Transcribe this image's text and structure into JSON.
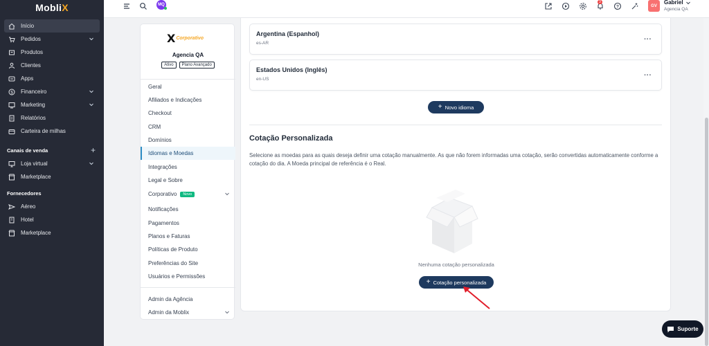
{
  "app": {
    "logo_main": "Mobli",
    "logo_x": "X"
  },
  "sidebar": {
    "items": [
      {
        "label": "Início",
        "icon": "home-icon"
      },
      {
        "label": "Pedidos",
        "icon": "cart-icon"
      },
      {
        "label": "Produtos",
        "icon": "box-icon"
      },
      {
        "label": "Clientes",
        "icon": "users-icon"
      },
      {
        "label": "Apps",
        "icon": "apps-icon"
      },
      {
        "label": "Financeiro",
        "icon": "dollar-icon"
      },
      {
        "label": "Marketing",
        "icon": "megaphone-icon"
      },
      {
        "label": "Relatórios",
        "icon": "report-icon"
      },
      {
        "label": "Carteira de milhas",
        "icon": "wallet-icon"
      }
    ],
    "sections": [
      {
        "title": "Canais de venda",
        "items": [
          {
            "label": "Loja virtual"
          },
          {
            "label": "Marketplace"
          }
        ]
      },
      {
        "title": "Fornecedores",
        "items": [
          {
            "label": "Aéreo"
          },
          {
            "label": "Hotel"
          },
          {
            "label": "Marketplace"
          }
        ]
      }
    ]
  },
  "topbar": {
    "avatar_initials": "MQ",
    "notif_count": "3",
    "user_initials": "GV",
    "user_name": "Gabriel",
    "user_agency": "Agencia QA"
  },
  "settings_menu": {
    "brand_x": "X",
    "brand_text": "Corporativo",
    "agency": "Agencia QA",
    "badge_active": "Ativo",
    "badge_plan": "Plano Avançado",
    "items": [
      "Geral",
      "Afiliados e Indicações",
      "Checkout",
      "CRM",
      "Domínios",
      "Idiomas e Moedas",
      "Integrações",
      "Legal e Sobre",
      "Corporativo",
      "Notificações",
      "Pagamentos",
      "Planos e Faturas",
      "Políticas de Produto",
      "Preferências do Site",
      "Usuários e Permissões"
    ],
    "corporativo_badge": "Novo",
    "footer_items": [
      "Admin da Agência",
      "Admin da Moblix"
    ]
  },
  "main": {
    "languages": [
      {
        "name": "Argentina (Espanhol)",
        "code": "es-AR"
      },
      {
        "name": "Estados Unidos (Inglês)",
        "code": "en-US"
      }
    ],
    "new_language_button": "Novo idioma",
    "section_title": "Cotação Personalizada",
    "section_desc": "Selecione as moedas para as quais deseja definir uma cotação manualmente. As que não forem informadas uma cotação, serão convertidas automaticamente conforme a cotação do dia. A Moeda principal de referência é o Real.",
    "empty_text": "Nenhuma cotação personalizada",
    "custom_quote_button": "Cotação personalizada"
  },
  "support": {
    "label": "Suporte"
  },
  "colors": {
    "sidebar_bg": "#262a36",
    "primary_navy": "#1e3a5f",
    "active_item": "#2b8cc4",
    "new_badge": "#10b981",
    "brand_orange": "#f5a623",
    "arrow_red": "#e11d2a"
  }
}
